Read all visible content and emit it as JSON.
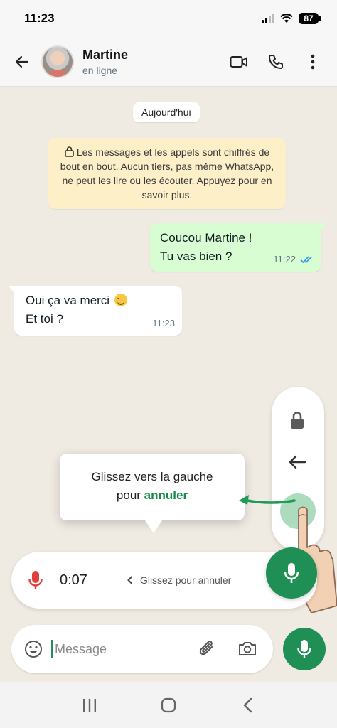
{
  "status_bar": {
    "time": "11:23",
    "battery": "87"
  },
  "header": {
    "contact_name": "Martine",
    "contact_status": "en ligne",
    "icons": [
      "back-arrow-icon",
      "video-call-icon",
      "phone-icon",
      "more-vert-icon"
    ]
  },
  "chat": {
    "date_chip": "Aujourd'hui",
    "encryption_notice": "Les messages et les appels sont chiffrés de bout en bout. Aucun tiers, pas même WhatsApp, ne peut les lire ou les écouter. Appuyez pour en savoir plus.",
    "messages": [
      {
        "direction": "outgoing",
        "lines": [
          "Coucou Martine !",
          "Tu vas bien ?"
        ],
        "time": "11:22",
        "status": "read"
      },
      {
        "direction": "incoming",
        "lines": [
          "Oui ça va merci",
          "Et toi ?"
        ],
        "time": "11:23",
        "emoji": "smiling-face"
      }
    ]
  },
  "tooltip": {
    "line1": "Glissez vers la gauche",
    "line2_prefix": "pour ",
    "line2_accent": "annuler"
  },
  "recording": {
    "timer": "0:07",
    "hint": "Glissez pour annuler"
  },
  "composer": {
    "placeholder": "Message"
  },
  "colors": {
    "accent_green": "#1f8f55",
    "outgoing_bubble": "#d8fdd2",
    "notice_bg": "#fdf0c8",
    "chat_bg": "#efeae2",
    "recording_mic": "#e0403a",
    "read_ticks": "#34a0e0"
  }
}
